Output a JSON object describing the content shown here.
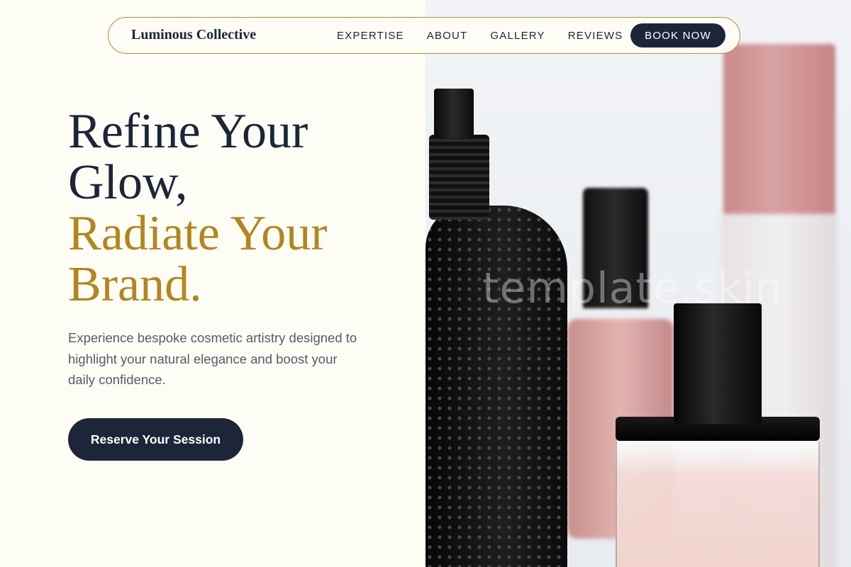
{
  "nav": {
    "brand": "Luminous Collective",
    "links": [
      "EXPERTISE",
      "ABOUT",
      "GALLERY",
      "REVIEWS"
    ],
    "cta_label": "BOOK NOW"
  },
  "hero": {
    "headline_line1": "Refine Your",
    "headline_line2": "Glow,",
    "headline_accent_line1": "Radiate Your",
    "headline_accent_line2": "Brand.",
    "description": "Experience bespoke cosmetic artistry designed to highlight your natural elegance and boost your daily confidence.",
    "cta_label": "Reserve Your Session"
  },
  "image": {
    "watermark": "template.skin"
  },
  "colors": {
    "navy": "#1c2638",
    "gold": "#b3861d",
    "background": "#fdfcf5",
    "body_text": "#565c68"
  }
}
